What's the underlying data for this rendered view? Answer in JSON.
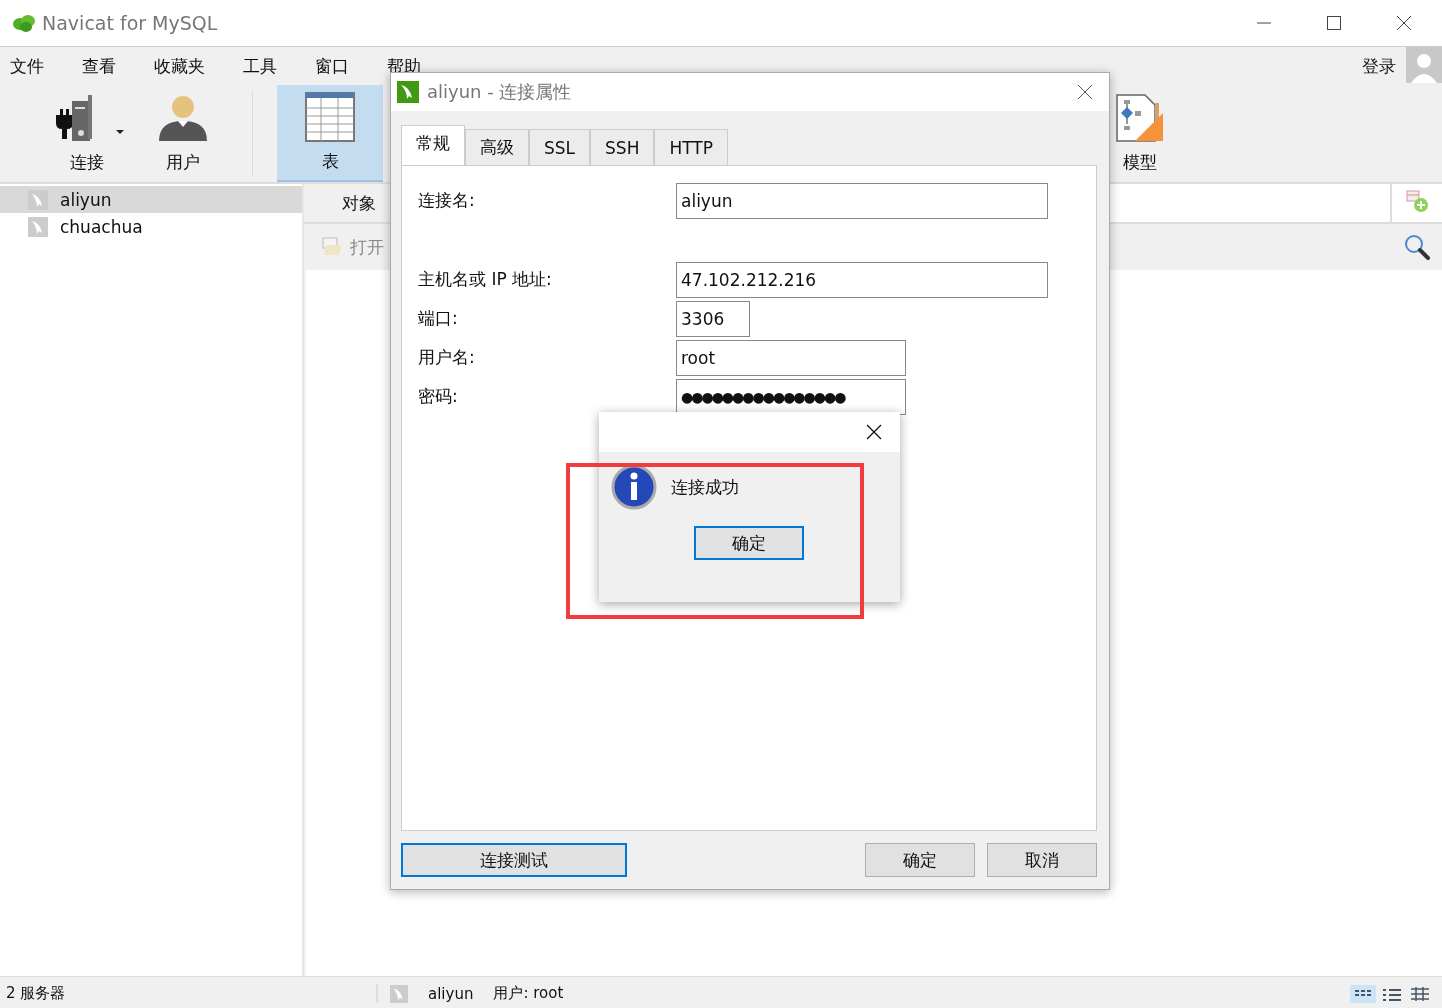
{
  "window": {
    "title": "Navicat for MySQL"
  },
  "menu": [
    {
      "label": "文件"
    },
    {
      "label": "查看"
    },
    {
      "label": "收藏夹"
    },
    {
      "label": "工具"
    },
    {
      "label": "窗口"
    },
    {
      "label": "帮助"
    }
  ],
  "login": {
    "label": "登录"
  },
  "toolbar": [
    {
      "label": "连接",
      "kind": "connection",
      "selected": false
    },
    {
      "label": "用户",
      "kind": "user",
      "selected": false
    },
    {
      "label": "表",
      "kind": "table",
      "selected": true
    },
    {
      "label": "模型",
      "kind": "model",
      "selected": false
    }
  ],
  "sidebar": {
    "items": [
      {
        "name": "aliyun",
        "selected": true
      },
      {
        "name": "chuachua",
        "selected": false
      }
    ]
  },
  "object_tab": {
    "label": "对象"
  },
  "open_table": {
    "label": "打开"
  },
  "status_bar": {
    "servers": "2 服务器",
    "connection": "aliyun",
    "user": "用户: root"
  },
  "dialog": {
    "title": "aliyun - 连接属性",
    "tabs": [
      {
        "label": "常规",
        "selected": true
      },
      {
        "label": "高级",
        "selected": false
      },
      {
        "label": "SSL",
        "selected": false
      },
      {
        "label": "SSH",
        "selected": false
      },
      {
        "label": "HTTP",
        "selected": false
      }
    ],
    "fields": [
      {
        "label": "连接名:",
        "value": "aliyun",
        "kind": "text"
      },
      {
        "label": "主机名或 IP 地址:",
        "value": "47.102.212.216",
        "kind": "text"
      },
      {
        "label": "端口:",
        "value": "3306",
        "kind": "text"
      },
      {
        "label": "用户名:",
        "value": "root",
        "kind": "text"
      },
      {
        "label": "密码:",
        "value": "●●●●●●●●●●●●●●●●",
        "kind": "password"
      }
    ],
    "test_button": "连接测试",
    "ok_button": "确定",
    "cancel_button": "取消"
  },
  "message_box": {
    "text": "连接成功",
    "button": "确定"
  }
}
